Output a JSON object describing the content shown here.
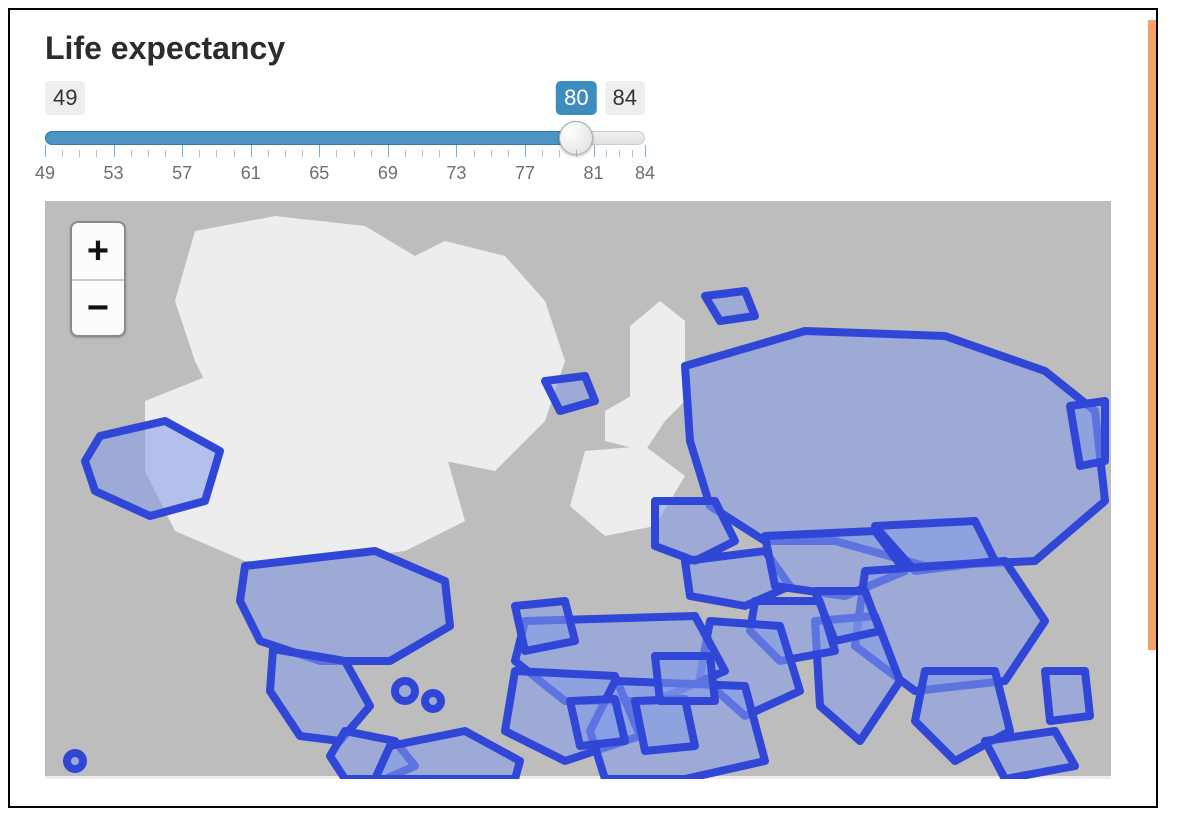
{
  "title": "Life expectancy",
  "slider": {
    "min_label": "49",
    "max_label": "84",
    "value_label": "80",
    "min": 49,
    "max": 84,
    "value": 80,
    "ticks": [
      "49",
      "53",
      "57",
      "61",
      "65",
      "69",
      "73",
      "77",
      "81",
      "84"
    ],
    "minor_per_major": 3
  },
  "zoom": {
    "in_label": "+",
    "out_label": "−"
  }
}
